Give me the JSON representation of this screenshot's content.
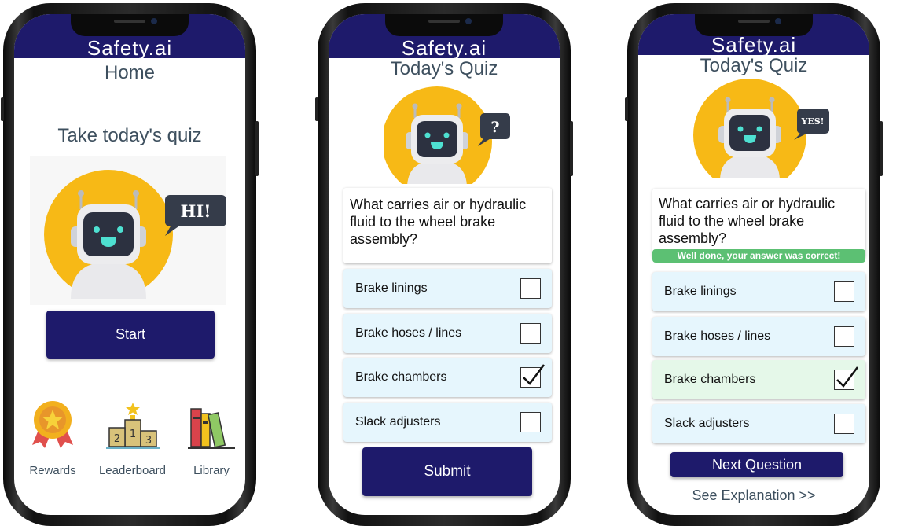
{
  "brand": "Safety.ai",
  "screen_home": {
    "title": "Home",
    "prompt": "Take today's quiz",
    "bubble": "HI!",
    "start_button": "Start",
    "nav": [
      {
        "label": "Rewards",
        "icon": "medal-icon"
      },
      {
        "label": "Leaderboard",
        "icon": "podium-icon"
      },
      {
        "label": "Library",
        "icon": "books-icon"
      }
    ]
  },
  "screen_quiz": {
    "title": "Today's Quiz",
    "bubble": "?",
    "question": "What carries air or hydraulic fluid to the wheel brake assembly?",
    "options": [
      {
        "label": "Brake linings",
        "checked": false
      },
      {
        "label": "Brake hoses / lines",
        "checked": false
      },
      {
        "label": "Brake chambers",
        "checked": true
      },
      {
        "label": "Slack adjusters",
        "checked": false
      }
    ],
    "submit_button": "Submit"
  },
  "screen_result": {
    "title": "Today's Quiz",
    "bubble": "YES!",
    "question": "What carries air or hydraulic fluid to the wheel brake assembly?",
    "feedback": "Well done, your answer was correct!",
    "options": [
      {
        "label": "Brake linings",
        "checked": false
      },
      {
        "label": "Brake hoses / lines",
        "checked": false
      },
      {
        "label": "Brake chambers",
        "checked": true
      },
      {
        "label": "Slack adjusters",
        "checked": false
      }
    ],
    "next_button": "Next Question",
    "explanation_link": "See Explanation >>"
  },
  "colors": {
    "header": "#1e1a6b",
    "primary_button": "#1e1a6b",
    "option_bg": "#e6f6fd",
    "correct_option_bg": "#e5f8e9",
    "success_banner": "#5cc073",
    "robot_circle": "#f7b916",
    "text": "#3d4f5e"
  }
}
